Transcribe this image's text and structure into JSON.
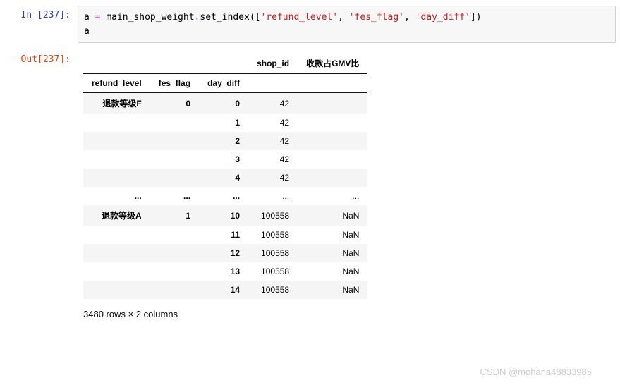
{
  "input": {
    "prompt": "In [237]:",
    "code_var": "a",
    "code_op": " = ",
    "code_obj": "main_shop_weight",
    "code_dot": ".",
    "code_fn": "set_index",
    "code_paren_open": "([",
    "code_arg1": "'refund_level'",
    "code_sep1": ", ",
    "code_arg2": "'fes_flag'",
    "code_sep2": ", ",
    "code_arg3": "'day_diff'",
    "code_paren_close": "])",
    "code_line2": "a"
  },
  "output": {
    "prompt": "Out[237]:",
    "columns": {
      "c1": "shop_id",
      "c2": "收款占GMV比"
    },
    "index_names": {
      "i1": "refund_level",
      "i2": "fes_flag",
      "i3": "day_diff"
    },
    "rows": [
      {
        "rl": "退款等级F",
        "ff": "0",
        "dd": "0",
        "shop": "42",
        "gmv": ""
      },
      {
        "rl": "",
        "ff": "",
        "dd": "1",
        "shop": "42",
        "gmv": ""
      },
      {
        "rl": "",
        "ff": "",
        "dd": "2",
        "shop": "42",
        "gmv": ""
      },
      {
        "rl": "",
        "ff": "",
        "dd": "3",
        "shop": "42",
        "gmv": ""
      },
      {
        "rl": "",
        "ff": "",
        "dd": "4",
        "shop": "42",
        "gmv": ""
      },
      {
        "rl": "...",
        "ff": "...",
        "dd": "...",
        "shop": "...",
        "gmv": "..."
      },
      {
        "rl": "退款等级A",
        "ff": "1",
        "dd": "10",
        "shop": "100558",
        "gmv": "NaN"
      },
      {
        "rl": "",
        "ff": "",
        "dd": "11",
        "shop": "100558",
        "gmv": "NaN"
      },
      {
        "rl": "",
        "ff": "",
        "dd": "12",
        "shop": "100558",
        "gmv": "NaN"
      },
      {
        "rl": "",
        "ff": "",
        "dd": "13",
        "shop": "100558",
        "gmv": "NaN"
      },
      {
        "rl": "",
        "ff": "",
        "dd": "14",
        "shop": "100558",
        "gmv": "NaN"
      }
    ],
    "summary": "3480 rows × 2 columns"
  },
  "watermark": "CSDN @mohana48833985"
}
